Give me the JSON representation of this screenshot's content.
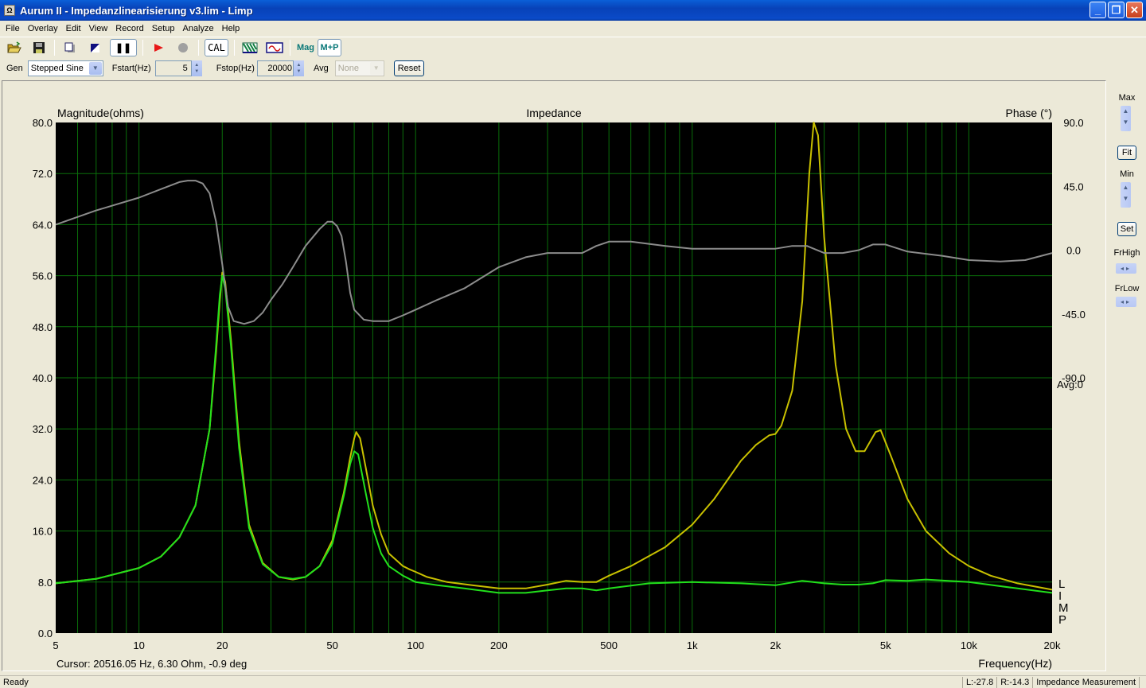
{
  "window": {
    "title": "Aurum II - Impedanzlinearisierung v3.lim - Limp",
    "app_icon": "app-icon",
    "buttons": {
      "minimize": "_",
      "restore": "❐",
      "close": "✕"
    }
  },
  "menu": [
    "File",
    "Overlay",
    "Edit",
    "View",
    "Record",
    "Setup",
    "Analyze",
    "Help"
  ],
  "toolbar": {
    "open_icon": "folder-open-icon",
    "save_icon": "floppy-disk-icon",
    "copy_icon": "page-copy-icon",
    "invert_icon": "half-triangle-icon",
    "pause_label": "❚❚",
    "play_icon": "play-icon",
    "record_icon": "record-icon",
    "cal_label": "CAL",
    "filter_icon": "filter-stripes-icon",
    "signal_icon": "sine-wave-icon",
    "mag_label": "Mag",
    "mp_label": "M+P"
  },
  "controls": {
    "gen_label": "Gen",
    "gen_value": "Stepped Sine",
    "fstart_label": "Fstart(Hz)",
    "fstart_value": "5",
    "fstop_label": "Fstop(Hz)",
    "fstop_value": "20000",
    "avg_label": "Avg",
    "avg_value": "None",
    "reset_label": "Reset"
  },
  "side": {
    "max_label": "Max",
    "fit_label": "Fit",
    "min_label": "Min",
    "set_label": "Set",
    "frhigh_label": "FrHigh",
    "frlow_label": "FrLow"
  },
  "chart_data": {
    "type": "line",
    "title": "Impedance",
    "ylabel": "Magnitude(ohms)",
    "y2label": "Phase (°)",
    "xlabel": "Frequency(Hz)",
    "xscale": "log",
    "xlim": [
      5,
      20000
    ],
    "ylim": [
      0,
      80
    ],
    "y2lim": [
      -270,
      90
    ],
    "yticks": [
      "80.0",
      "72.0",
      "64.0",
      "56.0",
      "48.0",
      "40.0",
      "32.0",
      "24.0",
      "16.0",
      "8.0",
      "0.0"
    ],
    "y2ticks": [
      "90.0",
      "45.0",
      "0.0",
      "-45.0",
      "-90.0"
    ],
    "y2_extra_label": "Avg:0",
    "xticks": [
      {
        "v": 5,
        "label": "5"
      },
      {
        "v": 10,
        "label": "10"
      },
      {
        "v": 20,
        "label": "20"
      },
      {
        "v": 50,
        "label": "50"
      },
      {
        "v": 100,
        "label": "100"
      },
      {
        "v": 200,
        "label": "200"
      },
      {
        "v": 500,
        "label": "500"
      },
      {
        "v": 1000,
        "label": "1k"
      },
      {
        "v": 2000,
        "label": "2k"
      },
      {
        "v": 5000,
        "label": "5k"
      },
      {
        "v": 10000,
        "label": "10k"
      },
      {
        "v": 20000,
        "label": "20k"
      }
    ],
    "grid": true,
    "legend_letters": [
      "L",
      "I",
      "M",
      "P"
    ],
    "cursor_readout": "Cursor: 20516.05 Hz, 6.30 Ohm, -0.9 deg",
    "colors": {
      "background": "#000000",
      "grid": "#0a6e0a",
      "overlay": "#c8c000",
      "magnitude": "#22e01c",
      "phase": "#8c8c8c"
    },
    "series": [
      {
        "name": "Overlay magnitude (ohms)",
        "color": "#c8c000",
        "x": [
          5,
          7,
          10,
          12,
          14,
          16,
          18,
          19,
          19.6,
          20,
          20.5,
          21.5,
          23,
          25,
          28,
          32,
          36,
          40,
          45,
          50,
          55,
          58,
          60,
          61,
          63,
          66,
          70,
          75,
          80,
          90,
          95,
          100,
          110,
          130,
          160,
          200,
          250,
          300,
          350,
          400,
          450,
          500,
          600,
          800,
          1000,
          1200,
          1500,
          1700,
          1900,
          2000,
          2100,
          2300,
          2500,
          2650,
          2750,
          2850,
          3000,
          3300,
          3600,
          3900,
          4200,
          4600,
          4800,
          5200,
          6000,
          7000,
          8500,
          10000,
          12000,
          15000,
          20000
        ],
        "values": [
          7.8,
          8.5,
          10.2,
          12.0,
          15.0,
          20.0,
          32.0,
          44.0,
          52.0,
          56.5,
          55.0,
          46.0,
          30.0,
          17.0,
          11.0,
          8.8,
          8.4,
          8.8,
          10.5,
          14.5,
          22.0,
          27.5,
          30.5,
          31.5,
          30.5,
          26.0,
          20.0,
          15.5,
          12.5,
          10.5,
          10.0,
          9.6,
          8.8,
          8.0,
          7.5,
          7.0,
          7.0,
          7.6,
          8.2,
          8.0,
          8.0,
          9.0,
          10.5,
          13.5,
          17.0,
          21.0,
          27.0,
          29.5,
          31.0,
          31.2,
          32.5,
          38.0,
          52.0,
          72.0,
          82.0,
          78.0,
          62.0,
          42.0,
          32.0,
          28.5,
          28.5,
          31.5,
          31.8,
          28.0,
          21.0,
          16.0,
          12.5,
          10.5,
          9.0,
          7.8,
          6.8
        ]
      },
      {
        "name": "Measured magnitude (ohms)",
        "color": "#22e01c",
        "x": [
          5,
          7,
          10,
          12,
          14,
          16,
          18,
          19,
          19.6,
          20,
          20.5,
          21.5,
          23,
          25,
          28,
          32,
          36,
          40,
          45,
          50,
          55,
          58,
          60,
          62,
          66,
          70,
          75,
          80,
          90,
          100,
          120,
          150,
          200,
          250,
          300,
          350,
          400,
          450,
          500,
          700,
          1000,
          1500,
          2000,
          2500,
          3000,
          3500,
          4000,
          4500,
          5000,
          6000,
          7000,
          10000,
          15000,
          20000
        ],
        "values": [
          7.8,
          8.5,
          10.2,
          12.0,
          15.0,
          20.0,
          32.0,
          45.0,
          53.0,
          56.0,
          54.0,
          45.0,
          29.0,
          16.5,
          10.8,
          8.8,
          8.5,
          8.8,
          10.5,
          14.0,
          21.5,
          26.5,
          28.5,
          28.0,
          22.0,
          16.5,
          12.5,
          10.5,
          9.0,
          8.0,
          7.5,
          7.0,
          6.3,
          6.3,
          6.7,
          7.0,
          7.0,
          6.7,
          7.0,
          7.8,
          8.0,
          7.8,
          7.5,
          8.2,
          7.8,
          7.6,
          7.6,
          7.8,
          8.3,
          8.2,
          8.4,
          8.0,
          7.0,
          6.3
        ]
      },
      {
        "name": "Phase (deg)",
        "color": "#8c8c8c",
        "axis": "y2",
        "x": [
          5,
          7,
          10,
          12,
          14,
          15,
          16,
          17,
          18,
          19,
          20,
          21,
          22,
          24,
          26,
          28,
          30,
          33,
          36,
          40,
          45,
          48,
          50,
          52,
          54,
          56,
          58,
          60,
          65,
          70,
          80,
          90,
          100,
          120,
          150,
          200,
          250,
          300,
          400,
          450,
          500,
          600,
          800,
          1000,
          1500,
          2000,
          2300,
          2600,
          3000,
          3500,
          4000,
          4500,
          5000,
          6000,
          8000,
          10000,
          13000,
          16000,
          20000
        ],
        "values": [
          18,
          28,
          37,
          43,
          48,
          49,
          49,
          47,
          40,
          20,
          -10,
          -40,
          -50,
          -52,
          -50,
          -44,
          -35,
          -24,
          -12,
          3,
          15,
          20,
          20,
          17,
          10,
          -8,
          -30,
          -42,
          -49,
          -50,
          -50,
          -46,
          -42,
          -35,
          -27,
          -12,
          -5,
          -2,
          -2,
          3,
          6,
          6,
          3,
          1,
          1,
          1,
          3,
          3,
          -2,
          -2,
          0,
          4,
          4,
          -1,
          -4,
          -7,
          -8,
          -7,
          -2
        ]
      }
    ]
  },
  "status": {
    "ready": "Ready",
    "left_level": "L:-27.8",
    "right_level": "R:-14.3",
    "mode": "Impedance Measurement"
  }
}
